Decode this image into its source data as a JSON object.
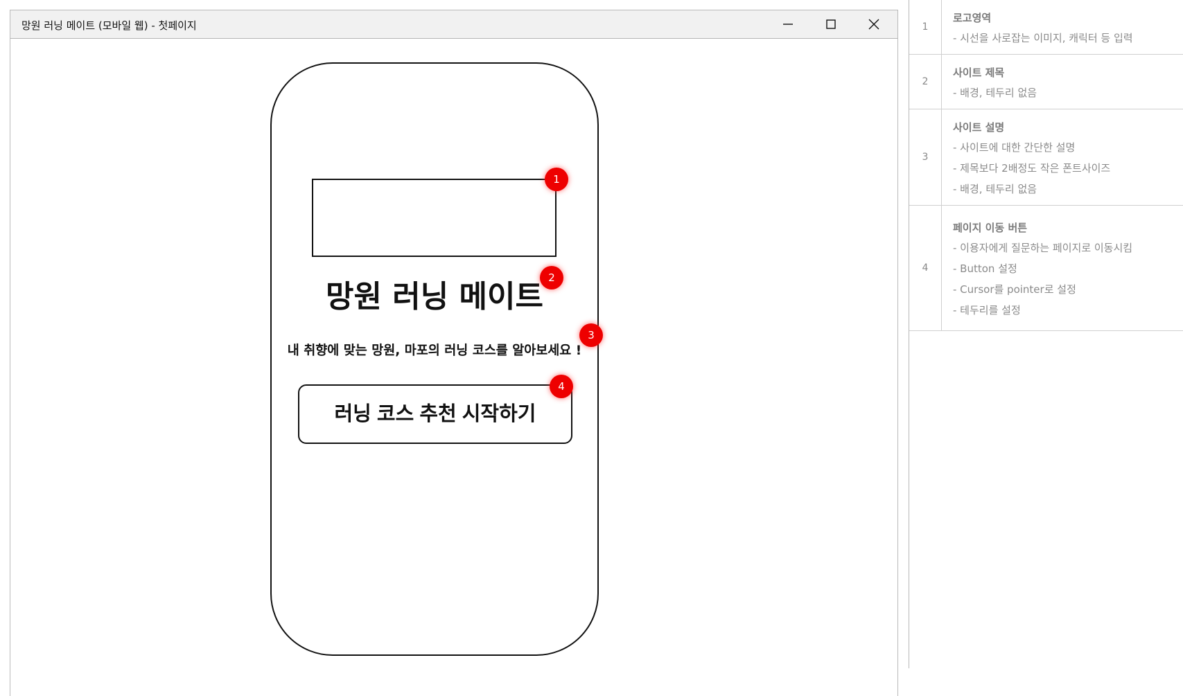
{
  "window": {
    "title": "망원 러닝 메이트 (모바일 웹) - 첫페이지"
  },
  "mockup": {
    "site_title": "망원 러닝 메이트",
    "site_description": "내 취향에 맞는 망원, 마포의 러닝 코스를 알아보세요 !",
    "start_button_label": "러닝 코스 추천 시작하기",
    "badges": [
      "1",
      "2",
      "3",
      "4"
    ]
  },
  "annotations": [
    {
      "number": "1",
      "title": "로고영역",
      "lines": [
        "- 시선을 사로잡는 이미지, 캐릭터 등 입력"
      ]
    },
    {
      "number": "2",
      "title": "사이트 제목",
      "lines": [
        "- 배경, 테두리 없음"
      ]
    },
    {
      "number": "3",
      "title": "사이트 설명",
      "lines": [
        "- 사이트에 대한 간단한 설명",
        "- 제목보다 2배정도 작은 폰트사이즈",
        "- 배경, 테두리 없음"
      ]
    },
    {
      "number": "4",
      "title": "페이지 이동 버튼",
      "lines": [
        "- 이용자에게 질문하는 페이지로 이동시킴",
        "- Button 설정",
        "- Cursor를 pointer로 설정",
        "- 테두리를 설정"
      ]
    }
  ],
  "icons": {
    "minimize": "minimize-icon",
    "maximize": "maximize-icon",
    "close": "close-icon"
  },
  "colors": {
    "badge": "#ee0000",
    "titlebar": "#f1f1f1",
    "annotation_text": "#8a8a8a"
  }
}
